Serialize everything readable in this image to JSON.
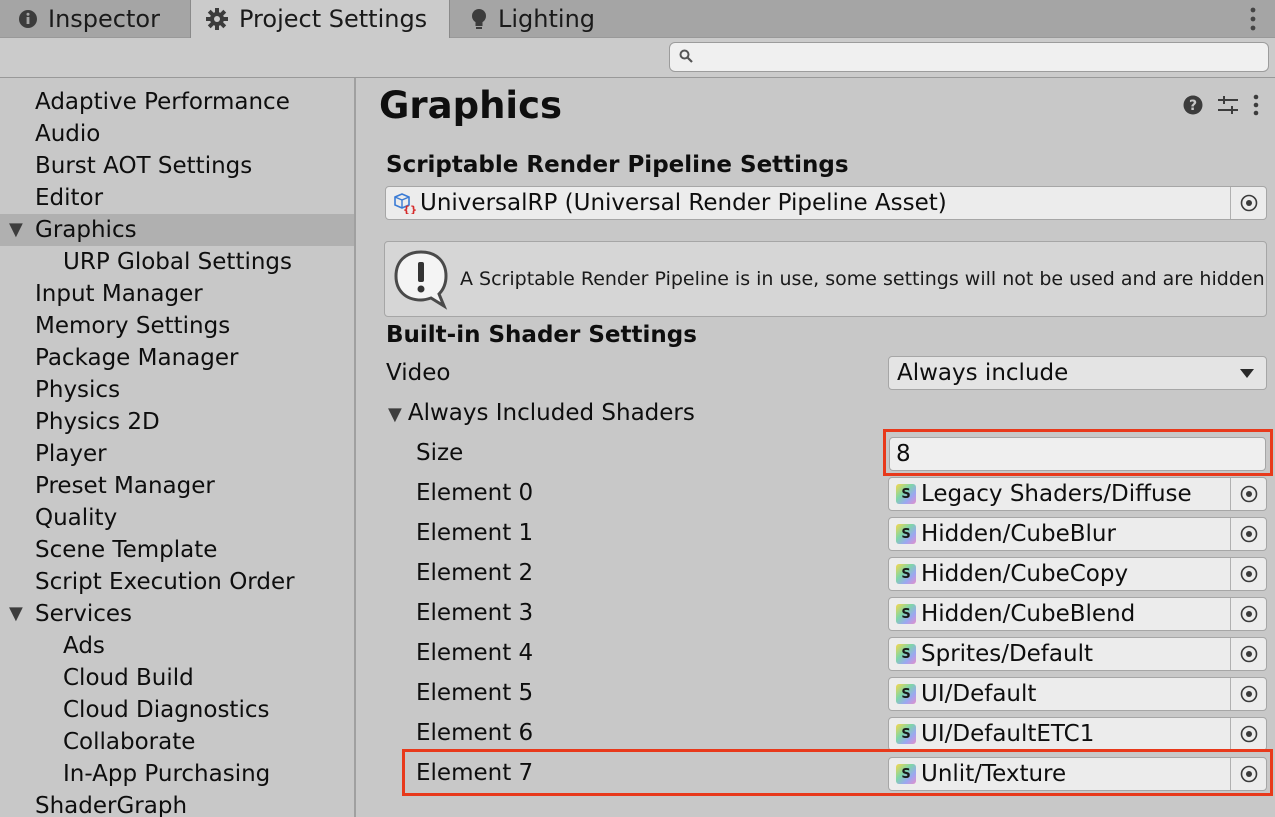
{
  "tabs": [
    {
      "label": "Inspector",
      "icon": "info-icon",
      "active": false
    },
    {
      "label": "Project Settings",
      "icon": "gear-icon",
      "active": true
    },
    {
      "label": "Lighting",
      "icon": "lightbulb-icon",
      "active": false
    }
  ],
  "search": {
    "placeholder": ""
  },
  "sidebar": {
    "items": [
      {
        "label": "Adaptive Performance"
      },
      {
        "label": "Audio"
      },
      {
        "label": "Burst AOT Settings"
      },
      {
        "label": "Editor"
      },
      {
        "label": "Graphics",
        "expanded": true,
        "selected": true
      },
      {
        "label": "URP Global Settings"
      },
      {
        "label": "Input Manager"
      },
      {
        "label": "Memory Settings"
      },
      {
        "label": "Package Manager"
      },
      {
        "label": "Physics"
      },
      {
        "label": "Physics 2D"
      },
      {
        "label": "Player"
      },
      {
        "label": "Preset Manager"
      },
      {
        "label": "Quality"
      },
      {
        "label": "Scene Template"
      },
      {
        "label": "Script Execution Order"
      },
      {
        "label": "Services",
        "expanded": true
      },
      {
        "label": "Ads"
      },
      {
        "label": "Cloud Build"
      },
      {
        "label": "Cloud Diagnostics"
      },
      {
        "label": "Collaborate"
      },
      {
        "label": "In-App Purchasing"
      },
      {
        "label": "ShaderGraph"
      }
    ]
  },
  "main": {
    "title": "Graphics",
    "srp_section": "Scriptable Render Pipeline Settings",
    "srp_asset": "UniversalRP (Universal Render Pipeline Asset)",
    "help_text": "A Scriptable Render Pipeline is in use, some settings will not be used and are hidden",
    "builtin_section": "Built-in Shader Settings",
    "video_label": "Video",
    "video_value": "Always include",
    "always_included_label": "Always Included Shaders",
    "size_label": "Size",
    "size_value": "8",
    "elements": [
      {
        "label": "Element 0",
        "value": "Legacy Shaders/Diffuse"
      },
      {
        "label": "Element 1",
        "value": "Hidden/CubeBlur"
      },
      {
        "label": "Element 2",
        "value": "Hidden/CubeCopy"
      },
      {
        "label": "Element 3",
        "value": "Hidden/CubeBlend"
      },
      {
        "label": "Element 4",
        "value": "Sprites/Default"
      },
      {
        "label": "Element 5",
        "value": "UI/Default"
      },
      {
        "label": "Element 6",
        "value": "UI/DefaultETC1"
      },
      {
        "label": "Element 7",
        "value": "Unlit/Texture"
      }
    ],
    "shader_icon_letter": "S"
  },
  "colors": {
    "highlight": "#e8391b",
    "selected_row": "#b0b0b0"
  }
}
